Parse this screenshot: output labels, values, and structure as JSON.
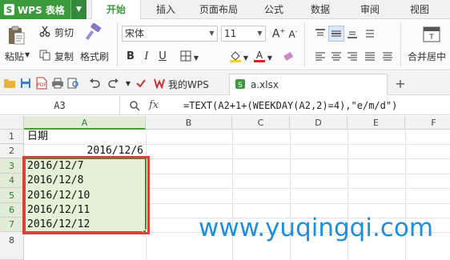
{
  "app": {
    "name": "WPS 表格"
  },
  "menu": {
    "tabs": [
      {
        "label": "开始",
        "active": true
      },
      {
        "label": "插入"
      },
      {
        "label": "页面布局"
      },
      {
        "label": "公式"
      },
      {
        "label": "数据"
      },
      {
        "label": "审阅"
      },
      {
        "label": "视图"
      }
    ]
  },
  "ribbon": {
    "paste_label": "粘贴",
    "cut_label": "剪切",
    "copy_label": "复制",
    "format_painter_label": "格式刷",
    "font_name": "宋体",
    "font_size": "11",
    "merge_center_label": "合并居中"
  },
  "docbar": {
    "tabs": [
      {
        "label": "我的WPS",
        "active": false
      },
      {
        "label": "a.xlsx",
        "active": true
      }
    ]
  },
  "formula_bar": {
    "cell_ref": "A3",
    "fx_label": "fx",
    "formula": "=TEXT(A2+1+(WEEKDAY(A2,2)=4),\"e/m/d\")"
  },
  "sheet": {
    "columns": [
      "A",
      "B",
      "C",
      "D",
      "E",
      "F"
    ],
    "rows": [
      "1",
      "2",
      "3",
      "4",
      "5",
      "6",
      "7",
      "8"
    ],
    "cells": {
      "A1": "日期",
      "A2": "2016/12/6",
      "A3": "2016/12/7",
      "A4": "2016/12/8",
      "A5": "2016/12/10",
      "A6": "2016/12/11",
      "A7": "2016/12/12"
    }
  },
  "watermark": "www.yuqingqi.com",
  "colors": {
    "accent": "#3c9a3c",
    "highlight": "#d9413a",
    "watermark": "#1e8fe0"
  }
}
